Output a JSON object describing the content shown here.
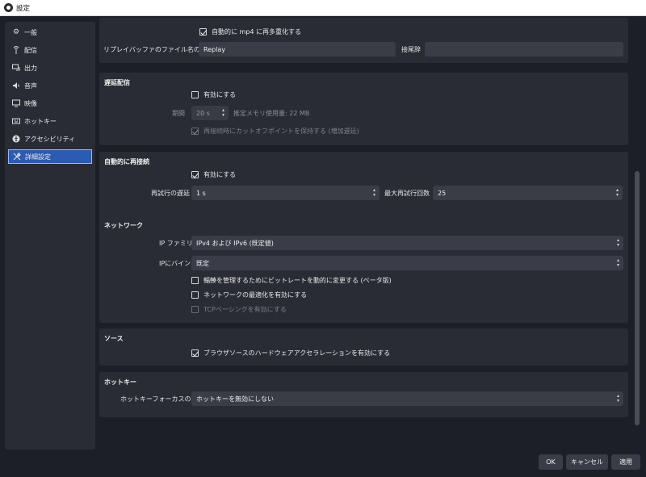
{
  "window": {
    "title": "設定"
  },
  "sidebar": {
    "items": [
      {
        "label": "一般",
        "icon": "gear-icon"
      },
      {
        "label": "配信",
        "icon": "antenna-icon"
      },
      {
        "label": "出力",
        "icon": "output-icon"
      },
      {
        "label": "音声",
        "icon": "speaker-icon"
      },
      {
        "label": "映像",
        "icon": "monitor-icon"
      },
      {
        "label": "ホットキー",
        "icon": "keyboard-icon"
      },
      {
        "label": "アクセシビリティ",
        "icon": "accessibility-icon"
      },
      {
        "label": "詳細設定",
        "icon": "wrench-icon"
      }
    ],
    "selected": "詳細設定"
  },
  "replay": {
    "auto_remux_label": "自動的に mp4 に再多重化する",
    "auto_remux_checked": true,
    "prefix_label": "リプレイバッファのファイル名の接頭辞",
    "prefix_value": "Replay",
    "suffix_label": "接尾辞",
    "suffix_value": ""
  },
  "delay": {
    "title": "遅延配信",
    "enable_label": "有効にする",
    "enable_checked": false,
    "duration_label": "期間",
    "duration_value": "20 s",
    "memory_text": "推定メモリ使用量: 22 MB",
    "preserve_label": "再接続時にカットオフポイントを保持する (増加遅延)",
    "preserve_checked": true
  },
  "reconnect": {
    "title": "自動的に再接続",
    "enable_label": "有効にする",
    "enable_checked": true,
    "retry_delay_label": "再試行の遅延",
    "retry_delay_value": "1 s",
    "max_retries_label": "最大再試行回数",
    "max_retries_value": "25"
  },
  "network": {
    "title": "ネットワーク",
    "ip_family_label": "IP ファミリー",
    "ip_family_value": "IPv4 および IPv6 (既定値)",
    "bind_ip_label": "IPにバインド",
    "bind_ip_value": "既定",
    "dynamic_bitrate_label": "輻輳を管理するためにビットレートを動的に変更する (ベータ版)",
    "dynamic_bitrate_checked": false,
    "optimize_label": "ネットワークの最適化を有効にする",
    "optimize_checked": false,
    "tcp_pacing_label": "TCPペーシングを有効にする",
    "tcp_pacing_checked": false
  },
  "sources": {
    "title": "ソース",
    "hw_accel_label": "ブラウザソースのハードウェアアクセラレーションを有効にする",
    "hw_accel_checked": true
  },
  "hotkeys": {
    "title": "ホットキー",
    "focus_label": "ホットキーフォーカスの動作",
    "focus_value": "ホットキーを無効にしない"
  },
  "footer": {
    "ok_label": "OK",
    "cancel_label": "キャンセル",
    "apply_label": "適用"
  }
}
